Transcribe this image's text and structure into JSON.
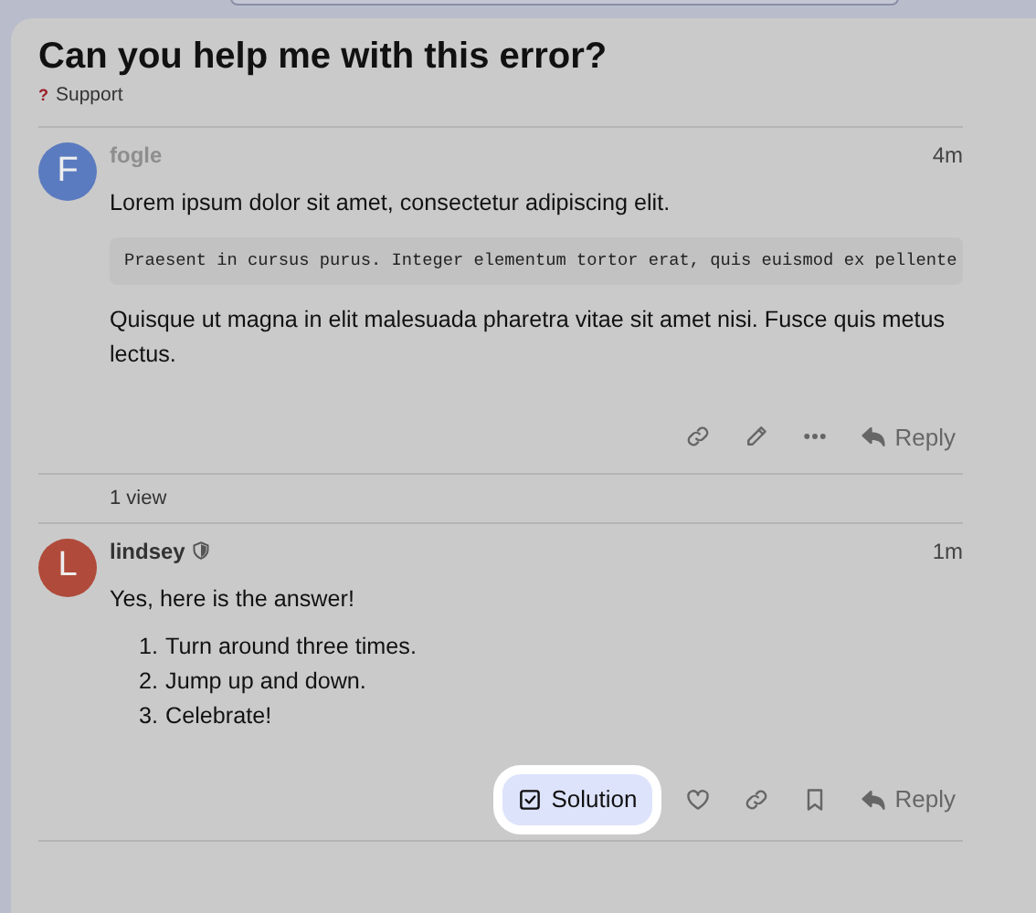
{
  "topic": {
    "title": "Can you help me with this error?",
    "category": {
      "icon": "?",
      "name": "Support",
      "color": "#9b1b25"
    }
  },
  "posts": [
    {
      "author": "fogle",
      "author_muted": true,
      "moderator": false,
      "avatar": {
        "letter": "F",
        "color": "#5b7bc0"
      },
      "time": "4m",
      "body": [
        {
          "kind": "paragraph",
          "text": "Lorem ipsum dolor sit amet, consectetur adipiscing elit."
        },
        {
          "kind": "code",
          "text": "Praesent in cursus purus. Integer elementum tortor erat, quis euismod ex pellente"
        },
        {
          "kind": "paragraph",
          "text": "Quisque ut magna in elit malesuada pharetra vitae sit amet nisi. Fusce quis metus lectus."
        }
      ],
      "actions": [
        {
          "kind": "link",
          "highlighted": false
        },
        {
          "kind": "edit",
          "highlighted": false
        },
        {
          "kind": "more",
          "highlighted": false
        },
        {
          "kind": "reply",
          "label": "Reply",
          "highlighted": false
        }
      ]
    },
    {
      "author": "lindsey",
      "author_muted": false,
      "moderator": true,
      "avatar": {
        "letter": "L",
        "color": "#b04a3a"
      },
      "time": "1m",
      "body": [
        {
          "kind": "paragraph",
          "text": "Yes, here is the answer!"
        },
        {
          "kind": "list",
          "items": [
            {
              "marker": "1.",
              "text": "Turn around three times."
            },
            {
              "marker": "2.",
              "text": "Jump up and down."
            },
            {
              "marker": "3.",
              "text": "Celebrate!"
            }
          ]
        }
      ],
      "actions": [
        {
          "kind": "solution",
          "label": "Solution",
          "highlighted": true
        },
        {
          "kind": "like",
          "highlighted": false
        },
        {
          "kind": "link",
          "highlighted": false
        },
        {
          "kind": "bookmark",
          "highlighted": false
        },
        {
          "kind": "reply",
          "label": "Reply",
          "highlighted": false
        }
      ]
    }
  ],
  "views": "1 view"
}
